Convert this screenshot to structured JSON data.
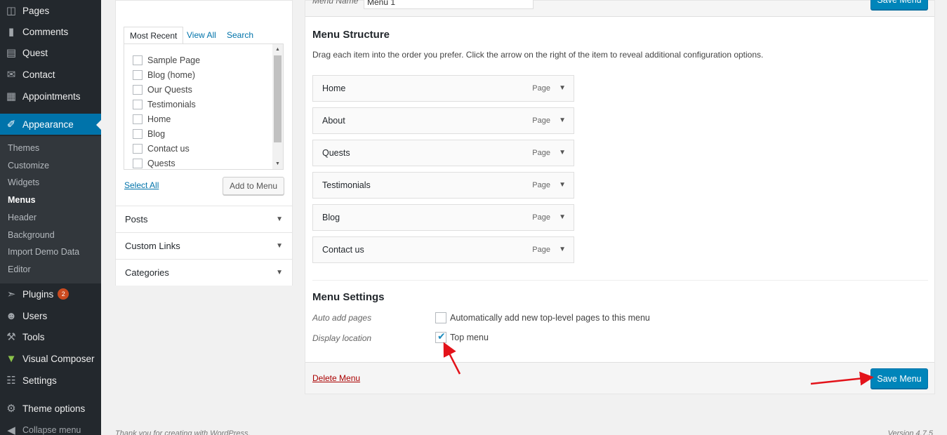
{
  "sidebar": {
    "items_top": [
      {
        "label": "Pages",
        "icon": "pages-icon"
      },
      {
        "label": "Comments",
        "icon": "comments-icon"
      },
      {
        "label": "Quest",
        "icon": "quest-icon"
      },
      {
        "label": "Contact",
        "icon": "mail-icon"
      },
      {
        "label": "Appointments",
        "icon": "calendar-icon"
      }
    ],
    "active": {
      "label": "Appearance",
      "icon": "paintbrush-icon"
    },
    "submenu": [
      "Themes",
      "Customize",
      "Widgets",
      "Menus",
      "Header",
      "Background",
      "Import Demo Data",
      "Editor"
    ],
    "current_submenu": "Menus",
    "plugins": {
      "label": "Plugins",
      "badge": "2"
    },
    "items_bottom": [
      {
        "label": "Users",
        "icon": "users-icon"
      },
      {
        "label": "Tools",
        "icon": "tools-icon"
      },
      {
        "label": "Visual Composer",
        "icon": "visual-composer-icon"
      },
      {
        "label": "Settings",
        "icon": "settings-icon"
      },
      {
        "label": "Theme options",
        "icon": "gear-icon"
      },
      {
        "label": "Collapse menu",
        "icon": "collapse-icon"
      }
    ]
  },
  "left_panel": {
    "tabs": [
      "Most Recent",
      "View All",
      "Search"
    ],
    "pages": [
      "Sample Page",
      "Blog (home)",
      "Our Quests",
      "Testimonials",
      "Home",
      "Blog",
      "Contact us",
      "Quests"
    ],
    "select_all": "Select All",
    "add_to_menu": "Add to Menu",
    "sections": [
      "Posts",
      "Custom Links",
      "Categories"
    ]
  },
  "main": {
    "menu_name_label": "Menu Name",
    "menu_name_value": "Menu 1",
    "save_menu": "Save Menu",
    "structure_title": "Menu Structure",
    "structure_desc": "Drag each item into the order you prefer. Click the arrow on the right of the item to reveal additional configuration options.",
    "items": [
      {
        "title": "Home",
        "type": "Page"
      },
      {
        "title": "About",
        "type": "Page"
      },
      {
        "title": "Quests",
        "type": "Page"
      },
      {
        "title": "Testimonials",
        "type": "Page"
      },
      {
        "title": "Blog",
        "type": "Page"
      },
      {
        "title": "Contact us",
        "type": "Page"
      }
    ],
    "settings_title": "Menu Settings",
    "auto_add_label": "Auto add pages",
    "auto_add_text": "Automatically add new top-level pages to this menu",
    "auto_add_checked": false,
    "display_location_label": "Display location",
    "top_menu_text": "Top menu",
    "top_menu_checked": true,
    "delete_menu": "Delete Menu"
  },
  "footer": {
    "left": "Thank you for creating with WordPress.",
    "right": "Version 4.7.5"
  },
  "colors": {
    "accent": "#0073aa",
    "button": "#0085ba",
    "arrow": "#e3131a",
    "sidebar": "#23282d"
  }
}
